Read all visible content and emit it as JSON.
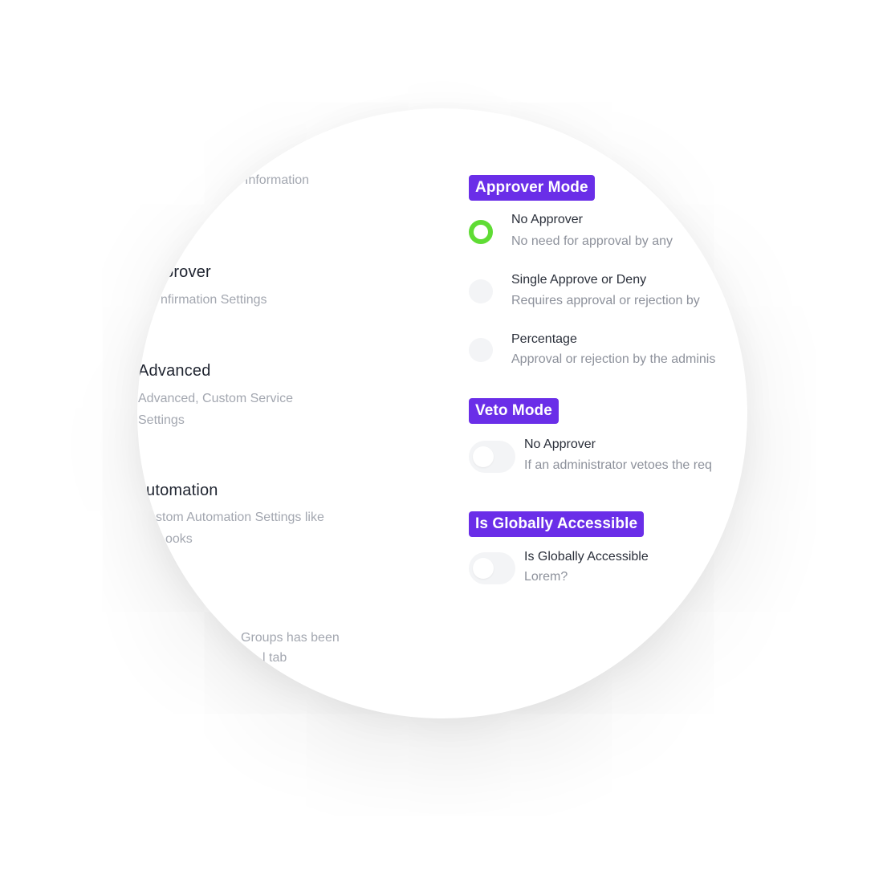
{
  "menu": {
    "items": [
      {
        "title": "",
        "desc_lines": [
          "Information"
        ]
      },
      {
        "title": "prover",
        "desc_lines": [
          "nfirmation Settings"
        ]
      },
      {
        "title": "Advanced",
        "desc_lines": [
          "Advanced, Custom Service",
          "Settings"
        ]
      },
      {
        "title": "utomation",
        "desc_lines": [
          "stom Automation Settings like",
          "ooks"
        ]
      },
      {
        "title": "",
        "desc_lines": [
          "Groups has been",
          "l tab"
        ]
      }
    ]
  },
  "approver_mode": {
    "title": "Approver Mode",
    "options": [
      {
        "label": "No Approver",
        "desc": "No need for approval by any",
        "selected": true
      },
      {
        "label": "Single Approve or Deny",
        "desc": "Requires approval or rejection by",
        "selected": false
      },
      {
        "label": "Percentage",
        "desc": "Approval or rejection by the adminis",
        "selected": false
      }
    ]
  },
  "veto_mode": {
    "title": "Veto Mode",
    "toggle": {
      "label": "No Approver",
      "desc": "If an administrator vetoes the req",
      "enabled": false
    }
  },
  "global_access": {
    "title": "Is Globally Accessible",
    "toggle": {
      "label": "Is Globally Accessible",
      "desc": "Lorem?",
      "enabled": false
    }
  },
  "colors": {
    "accent": "#6a2ee8",
    "radio_selected": "#5fdc34",
    "control_off": "#f3f4f6"
  }
}
